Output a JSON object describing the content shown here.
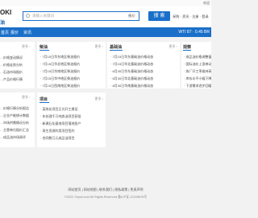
{
  "topbar": {
    "right_text": "欢迎"
  },
  "header": {
    "logo_line1": "OKI",
    "logo_line2": "油",
    "search_placeholder": "请输入关键词",
    "search_scope": "报价",
    "search_button": "搜 索",
    "links": "采购 · 资讯 · 注册 · 登录"
  },
  "nav": {
    "items": [
      "首页",
      "报价",
      "资讯"
    ],
    "right_text": "WTI 87 · 0.45 BR"
  },
  "panels": {
    "p1": {
      "title": "",
      "more": "更多 ›",
      "items": [
        "…价格变动情况",
        "…价格走势分析",
        "…石油市场报价",
        "…产品价格行情",
        "…价格参考数据"
      ]
    },
    "p2": {
      "title": "柴油",
      "more": "更多 ›",
      "items": [
        "· 7月15日华东地区柴油报价",
        "· 7月15日华北地区柴油报价",
        "· 7月15日华南地区柴油报价",
        "· 7月15日华中地区柴油报价",
        "· 7月15日西南地区柴油报价"
      ]
    },
    "p3": {
      "title": "基础油",
      "more": "更多 ›",
      "items": [
        "· 7月15日华东基础油价格动态",
        "· 7月15日华北基础油价格动态",
        "· 6月30日华东基础油价格动态",
        "· 6月30日华北基础油价格动态",
        "· 6月30日华南基础油价格动态"
      ]
    },
    "p4": {
      "title": "观察",
      "more": "更多 ›",
      "items": [
        "· 成品油价格调整窗口开启",
        "· 国际油价上涨带动市场情绪",
        "· 炼厂开工率维持高位运行",
        "· 库存水平小幅下降",
        "· 下游需求逐步回暖"
      ]
    },
    "p5": {
      "title": "",
      "more": "更多 ›",
      "items": [
        "…价格行情分析报告",
        "…企业产能统计数据",
        "…市场供需情况分析",
        "…主营单位报价汇总",
        "…成品油市场周评"
      ]
    },
    "p6": {
      "title": "项目",
      "more": "更多 ›",
      "items": [
        "· 某炼化项目正式开工建设",
        "· 年处理千万吨炼油项目获批",
        "· 新建石化基地项目落地投产",
        "· 再生资源利用项目签约",
        "· 合同数万元成品油项目"
      ]
    }
  },
  "footer": {
    "links": "网站首页 | 网站地图 | 联系我们 | 隐私政策 | 免责声明",
    "copyright": "©2022 Xhyoil.com All Rights Reserved 备ICP证-12345678号"
  }
}
